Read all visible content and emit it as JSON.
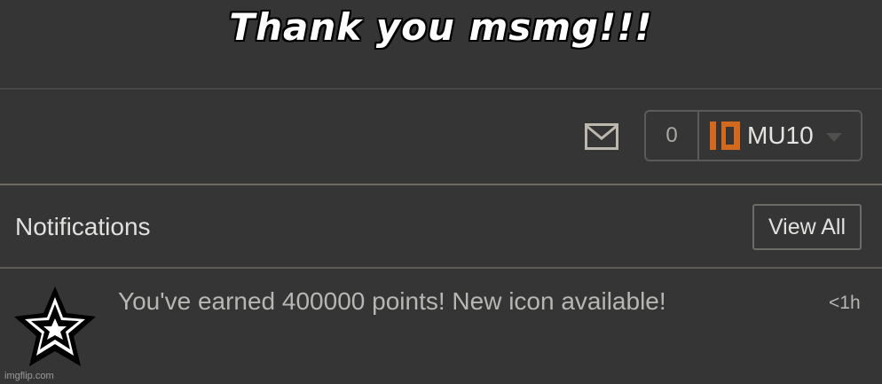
{
  "caption": "Thank you msmg!!!",
  "header": {
    "points": "0",
    "username": "MU10",
    "logo_color": "#d3691e"
  },
  "notifications": {
    "title": "Notifications",
    "view_all_label": "View All",
    "items": [
      {
        "icon": "star-icon",
        "text": "You've earned 400000 points! New icon available!",
        "time": "<1h"
      }
    ]
  },
  "watermark": "imgflip.com"
}
